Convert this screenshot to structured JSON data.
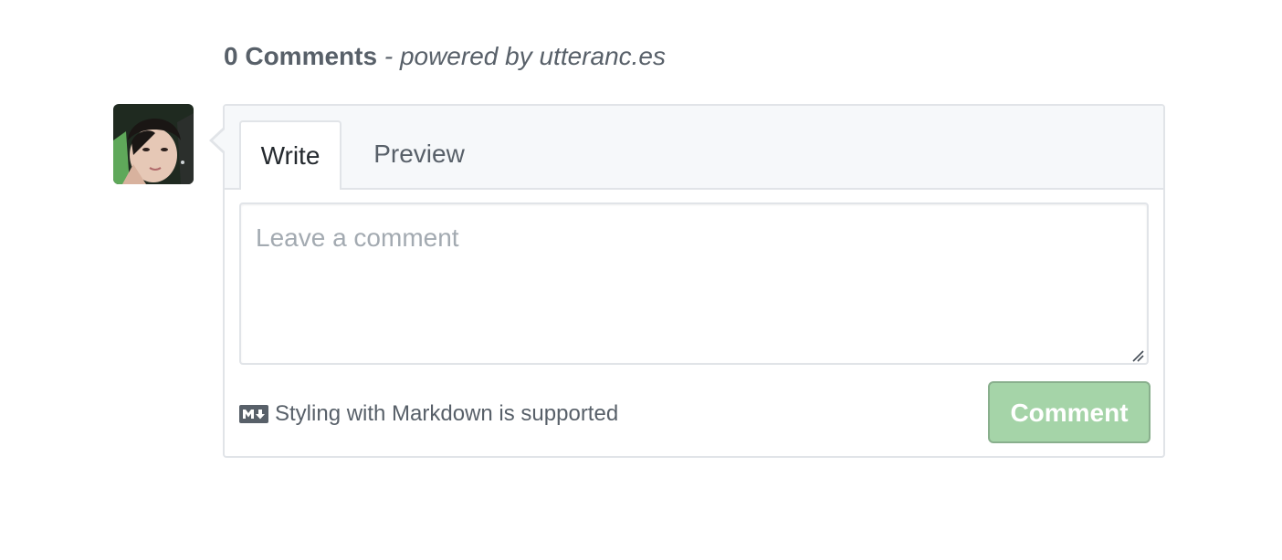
{
  "header": {
    "count_label": "0 Comments",
    "separator": " - ",
    "powered_by": "powered by utteranc.es"
  },
  "avatar": {
    "alt": "user avatar"
  },
  "tabs": [
    {
      "label": "Write",
      "selected": true
    },
    {
      "label": "Preview",
      "selected": false
    }
  ],
  "editor": {
    "placeholder": "Leave a comment",
    "value": ""
  },
  "footer": {
    "markdown_note": "Styling with Markdown is supported",
    "markdown_icon": "markdown-icon",
    "comment_button_label": "Comment",
    "comment_button_color": "#a5d4a8"
  }
}
